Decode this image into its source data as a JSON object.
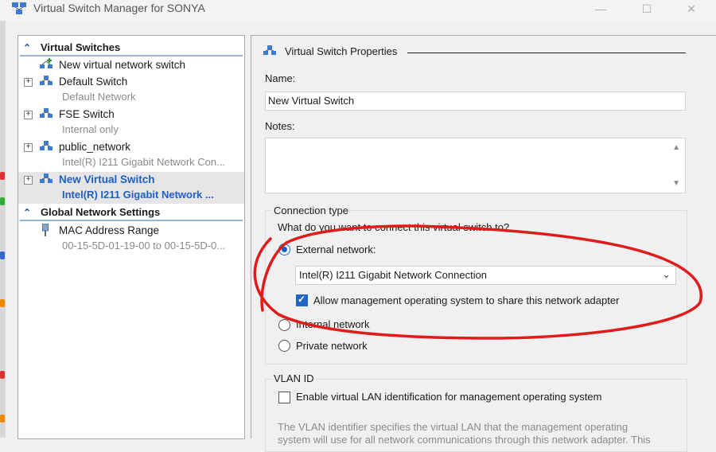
{
  "window": {
    "title": "Virtual Switch Manager for SONYA",
    "minimize": "—",
    "maximize": "☐",
    "close": "✕"
  },
  "tree": {
    "virtual_switches_header": "Virtual Switches",
    "global_settings_header": "Global Network Settings",
    "items": [
      {
        "name": "New virtual network switch",
        "sub": ""
      },
      {
        "name": "Default Switch",
        "sub": "Default Network"
      },
      {
        "name": "FSE Switch",
        "sub": "Internal only"
      },
      {
        "name": "public_network",
        "sub": "Intel(R) I211 Gigabit Network Con..."
      },
      {
        "name": "New Virtual Switch",
        "sub": "Intel(R) I211 Gigabit Network ..."
      }
    ],
    "mac": {
      "name": "MAC Address Range",
      "sub": "00-15-5D-01-19-00 to 00-15-5D-0..."
    }
  },
  "props": {
    "section_title": "Virtual Switch Properties",
    "name_label": "Name:",
    "name_value": "New Virtual Switch",
    "notes_label": "Notes:",
    "connection_type_label": "Connection type",
    "connection_question": "What do you want to connect this virtual switch to?",
    "external_label": "External network:",
    "adapter_value": "Intel(R) I211 Gigabit Network Connection",
    "allow_mgmt_label": "Allow management operating system to share this network adapter",
    "internal_label": "Internal network",
    "private_label": "Private network",
    "vlan_title": "VLAN ID",
    "vlan_enable_label": "Enable virtual LAN identification for management operating system",
    "vlan_desc_1": "The VLAN identifier specifies the virtual LAN that the management operating",
    "vlan_desc_2": "system will use for all network communications through this network adapter. This"
  },
  "state": {
    "selected_connection": "external",
    "allow_mgmt_checked": true,
    "vlan_enabled": false
  },
  "colors": {
    "annotation": "#e01b1b",
    "selection_text": "#1f5fbf",
    "header_text": "#1f4e9c"
  }
}
